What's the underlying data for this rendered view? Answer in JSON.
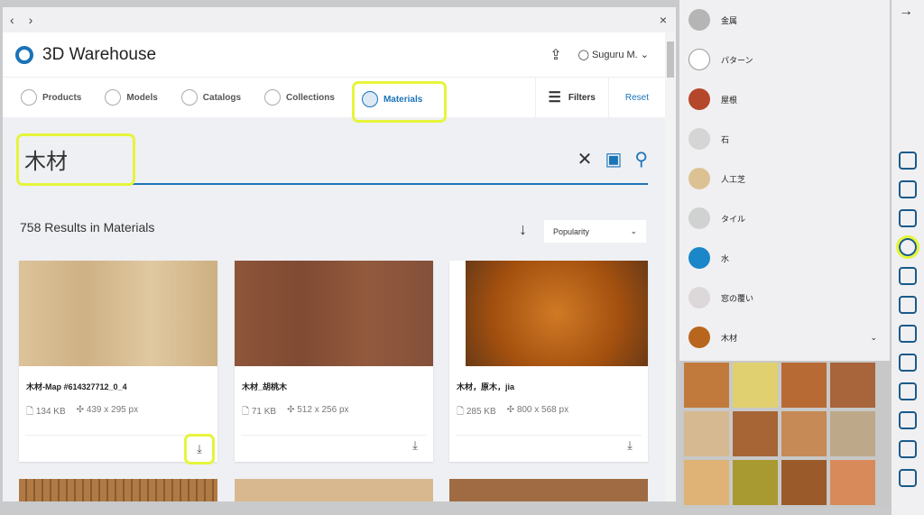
{
  "nav": {
    "back": "‹",
    "forward": "›",
    "close": "×"
  },
  "header": {
    "brand": "3D Warehouse",
    "user": "Suguru M.",
    "upload_icon": "upload-icon",
    "user_icon": "user-icon"
  },
  "tabs": [
    {
      "label": "Products"
    },
    {
      "label": "Models"
    },
    {
      "label": "Catalogs"
    },
    {
      "label": "Collections"
    },
    {
      "label": "Materials",
      "active": true
    }
  ],
  "filters": {
    "label": "Filters",
    "reset": "Reset"
  },
  "search": {
    "value": "木材",
    "clear": "✕",
    "image_search": "▣",
    "search": "⚲"
  },
  "results": {
    "text": "758 Results in Materials",
    "sort": "Popularity",
    "sort_arrow": "↓"
  },
  "cards": [
    {
      "title": "木材-Map #614327712_0_4",
      "size": "134 KB",
      "dims": "439 x 295 px",
      "color": "#d9bf94"
    },
    {
      "title": "木材_胡桃木",
      "size": "71 KB",
      "dims": "512 x 256 px",
      "color": "#8a5237"
    },
    {
      "title": "木材，原木，jia",
      "size": "285 KB",
      "dims": "800 x 568 px",
      "color": "#b8601c"
    }
  ],
  "row2_colors": [
    "#b07a45",
    "#d8b98f",
    "#a06b42"
  ],
  "materials_panel": {
    "items": [
      {
        "label": "金属",
        "color": "#b5b5b5"
      },
      {
        "label": "パターン",
        "color": "#ffffff"
      },
      {
        "label": "屋根",
        "color": "#b5472a"
      },
      {
        "label": "石",
        "color": "#d5d5d5"
      },
      {
        "label": "人工芝",
        "color": "#dcc293"
      },
      {
        "label": "タイル",
        "color": "#d0d1d1"
      },
      {
        "label": "水",
        "color": "#1b86c8"
      },
      {
        "label": "窓の覆い",
        "color": "#dcd8da"
      },
      {
        "label": "木材",
        "color": "#b8651e"
      }
    ],
    "expand": "⌄",
    "swatches": [
      "#c17a3b",
      "#e0d070",
      "#b86a34",
      "#a8643a",
      "#d6b990",
      "#a76535",
      "#c58a55",
      "#bda88a",
      "#dfb375",
      "#a89a30",
      "#9a5a2a",
      "#d88a5a"
    ]
  },
  "toolbar_icons": [
    "arrow-right-icon",
    "components-icon",
    "outliner-icon",
    "instructor-icon",
    "materials-icon",
    "styles-icon",
    "tags-icon",
    "scenes-icon",
    "eraser-icon",
    "animation-icon",
    "display-icon",
    "entity-info-icon",
    "warehouse-icon"
  ]
}
